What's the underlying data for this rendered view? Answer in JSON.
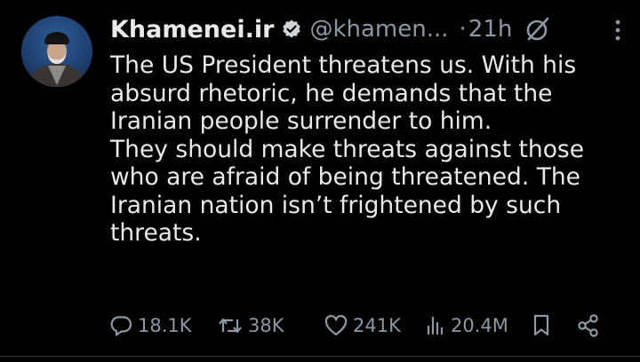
{
  "author": {
    "name": "Khamenei.ir",
    "handle": "@khamen...",
    "separator": "·",
    "time": "21h"
  },
  "tweet": {
    "text": "The US President threatens us. With his absurd rhetoric, he demands that the Iranian people surrender to him.\nThey should make threats against those who are afraid of being threatened. The Iranian nation isn’t frightened by such threats."
  },
  "actions": {
    "replies": "18.1K",
    "reposts": "38K",
    "likes": "241K",
    "views": "20.4M"
  },
  "colors": {
    "background": "#000000",
    "text": "#e7e9ea",
    "secondary": "#8b98a5",
    "verified_badge": "#cfd4d8"
  },
  "icons": [
    "verified-badge-icon",
    "grok-icon",
    "more-icon",
    "reply-icon",
    "repost-icon",
    "like-icon",
    "views-icon",
    "bookmark-icon",
    "share-icon"
  ]
}
